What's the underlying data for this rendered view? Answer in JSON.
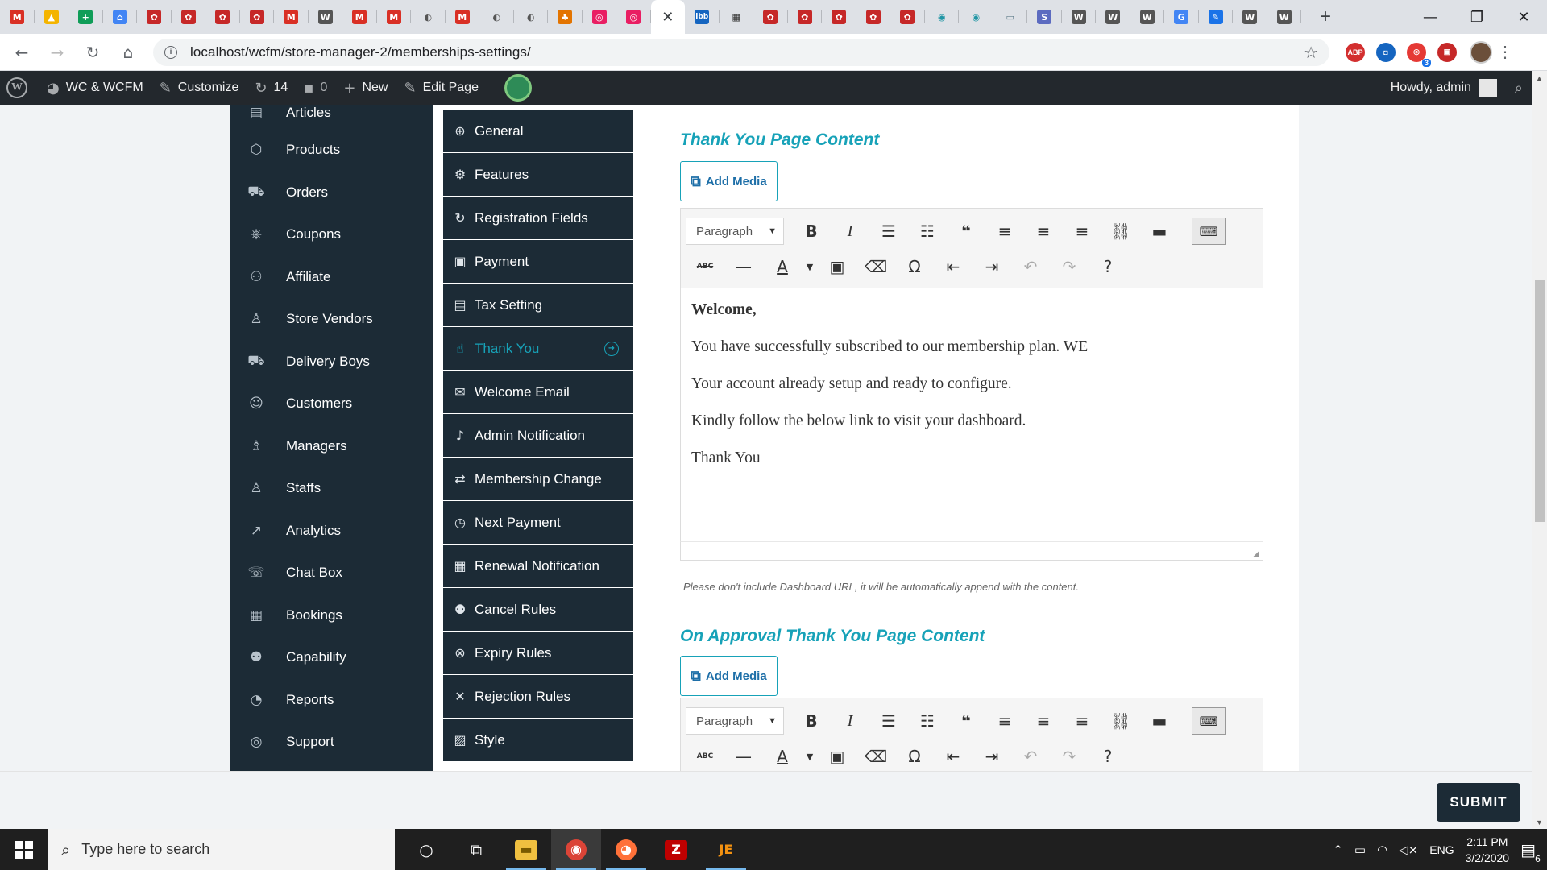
{
  "browser": {
    "tabs": [
      {
        "icon": "gmail-icon",
        "glyph": "M",
        "color": "#d93025"
      },
      {
        "icon": "drive-icon",
        "glyph": "▲",
        "color": "#f4b400"
      },
      {
        "icon": "sheets-icon",
        "glyph": "+",
        "color": "#0f9d58"
      },
      {
        "icon": "inbox-icon",
        "glyph": "⌂",
        "color": "#4285f4"
      },
      {
        "icon": "wcfm-icon",
        "glyph": "✿",
        "color": "#c62828"
      },
      {
        "icon": "wcfm-icon",
        "glyph": "✿",
        "color": "#c62828"
      },
      {
        "icon": "wcfm-icon",
        "glyph": "✿",
        "color": "#c62828"
      },
      {
        "icon": "wcfm-icon",
        "glyph": "✿",
        "color": "#c62828"
      },
      {
        "icon": "gmail-icon",
        "glyph": "M",
        "color": "#d93025"
      },
      {
        "icon": "wordpress-icon",
        "glyph": "W",
        "color": "#555555"
      },
      {
        "icon": "gmail-icon",
        "glyph": "M",
        "color": "#d93025"
      },
      {
        "icon": "gmail-icon",
        "glyph": "M",
        "color": "#d93025"
      },
      {
        "icon": "globe-icon",
        "glyph": "◐",
        "color": "#555555"
      },
      {
        "icon": "gmail-icon",
        "glyph": "M",
        "color": "#d93025"
      },
      {
        "icon": "globe-icon",
        "glyph": "◐",
        "color": "#555555"
      },
      {
        "icon": "globe-icon",
        "glyph": "◐",
        "color": "#555555"
      },
      {
        "icon": "pma-icon",
        "glyph": "♣",
        "color": "#e37400"
      },
      {
        "icon": "plugin-icon",
        "glyph": "◎",
        "color": "#e91e63"
      },
      {
        "icon": "plugin-icon",
        "glyph": "◎",
        "color": "#e91e63"
      },
      {
        "icon": "close-icon",
        "glyph": "✕",
        "color": "#3c4043",
        "active": true
      },
      {
        "icon": "ibb-icon",
        "glyph": "ibb",
        "color": "#1565c0"
      },
      {
        "icon": "clapper-icon",
        "glyph": "▦",
        "color": "#333333"
      },
      {
        "icon": "wcfm-icon",
        "glyph": "✿",
        "color": "#c62828"
      },
      {
        "icon": "wcfm-icon",
        "glyph": "✿",
        "color": "#c62828"
      },
      {
        "icon": "wcfm-icon",
        "glyph": "✿",
        "color": "#c62828"
      },
      {
        "icon": "wcfm-icon",
        "glyph": "✿",
        "color": "#c62828"
      },
      {
        "icon": "wcfm-icon",
        "glyph": "✿",
        "color": "#c62828"
      },
      {
        "icon": "globe-icon",
        "glyph": "◉",
        "color": "#2196a5"
      },
      {
        "icon": "globe-icon",
        "glyph": "◉",
        "color": "#2196a5"
      },
      {
        "icon": "monitor-icon",
        "glyph": "▭",
        "color": "#607d8b"
      },
      {
        "icon": "s-icon",
        "glyph": "S",
        "color": "#5c6bc0"
      },
      {
        "icon": "wordpress-icon",
        "glyph": "W",
        "color": "#555555"
      },
      {
        "icon": "wordpress-icon",
        "glyph": "W",
        "color": "#555555"
      },
      {
        "icon": "wordpress-icon",
        "glyph": "W",
        "color": "#555555"
      },
      {
        "icon": "google-icon",
        "glyph": "G",
        "color": "#4285f4"
      },
      {
        "icon": "feather-icon",
        "glyph": "✎",
        "color": "#1a73e8"
      },
      {
        "icon": "wordpress-icon",
        "glyph": "W",
        "color": "#555555"
      },
      {
        "icon": "wordpress-icon",
        "glyph": "W",
        "color": "#555555"
      }
    ],
    "url": "localhost/wcfm/store-manager-2/memberships-settings/",
    "extensions": [
      {
        "name": "adblock-icon",
        "text": "ABP",
        "color": "#d32f2f"
      },
      {
        "name": "camera-icon",
        "text": "◘",
        "color": "#1565c0"
      },
      {
        "name": "todo-icon",
        "text": "◎",
        "color": "#e53935",
        "badge": "3"
      },
      {
        "name": "pocket-icon",
        "text": "▣",
        "color": "#c62828"
      }
    ]
  },
  "adminbar": {
    "site_name": "WC & WCFM",
    "customize": "Customize",
    "updates_count": "14",
    "comments_count": "0",
    "new_label": "New",
    "edit_page": "Edit Page",
    "howdy": "Howdy, admin"
  },
  "left_menu": [
    {
      "label": "Articles",
      "icon": "article-icon",
      "glyph": "▤"
    },
    {
      "label": "Products",
      "icon": "cube-icon",
      "glyph": "⬡"
    },
    {
      "label": "Orders",
      "icon": "cart-icon",
      "glyph": "⛟"
    },
    {
      "label": "Coupons",
      "icon": "gift-icon",
      "glyph": "⎈"
    },
    {
      "label": "Affiliate",
      "icon": "users-icon",
      "glyph": "⚇"
    },
    {
      "label": "Store Vendors",
      "icon": "user-icon",
      "glyph": "♙"
    },
    {
      "label": "Delivery Boys",
      "icon": "truck-icon",
      "glyph": "⛟"
    },
    {
      "label": "Customers",
      "icon": "user-circle-icon",
      "glyph": "☺"
    },
    {
      "label": "Managers",
      "icon": "user-tie-icon",
      "glyph": "♗"
    },
    {
      "label": "Staffs",
      "icon": "user-icon",
      "glyph": "♙"
    },
    {
      "label": "Analytics",
      "icon": "chart-line-icon",
      "glyph": "↗"
    },
    {
      "label": "Chat Box",
      "icon": "chat-icon",
      "glyph": "☏"
    },
    {
      "label": "Bookings",
      "icon": "calendar-icon",
      "glyph": "▦"
    },
    {
      "label": "Capability",
      "icon": "user-x-icon",
      "glyph": "⚉"
    },
    {
      "label": "Reports",
      "icon": "pie-chart-icon",
      "glyph": "◔"
    },
    {
      "label": "Support",
      "icon": "lifering-icon",
      "glyph": "◎"
    }
  ],
  "sub_menu": [
    {
      "label": "General",
      "icon": "globe-icon",
      "glyph": "⊕"
    },
    {
      "label": "Features",
      "icon": "gear-icon",
      "glyph": "⚙"
    },
    {
      "label": "Registration Fields",
      "icon": "refresh-icon",
      "glyph": "↻"
    },
    {
      "label": "Payment",
      "icon": "money-icon",
      "glyph": "▣"
    },
    {
      "label": "Tax Setting",
      "icon": "id-card-icon",
      "glyph": "▤"
    },
    {
      "label": "Thank You",
      "icon": "thumbs-up-icon",
      "glyph": "☝",
      "active": true
    },
    {
      "label": "Welcome Email",
      "icon": "envelope-icon",
      "glyph": "✉"
    },
    {
      "label": "Admin Notification",
      "icon": "bell-icon",
      "glyph": "♪"
    },
    {
      "label": "Membership Change",
      "icon": "retweet-icon",
      "glyph": "⇄"
    },
    {
      "label": "Next Payment",
      "icon": "clock-icon",
      "glyph": "◷"
    },
    {
      "label": "Renewal Notification",
      "icon": "calendar-icon",
      "glyph": "▦"
    },
    {
      "label": "Cancel Rules",
      "icon": "user-x-icon",
      "glyph": "⚉"
    },
    {
      "label": "Expiry Rules",
      "icon": "circle-x-icon",
      "glyph": "⊗"
    },
    {
      "label": "Rejection Rules",
      "icon": "times-icon",
      "glyph": "✕"
    },
    {
      "label": "Style",
      "icon": "image-icon",
      "glyph": "▨"
    }
  ],
  "sections": {
    "thank_you_title": "Thank You Page Content",
    "approval_title": "On Approval Thank You Page Content",
    "add_media": "Add Media",
    "format_select": "Paragraph",
    "hint": "Please don't include Dashboard URL, it will be automatically append with the content."
  },
  "editor_content": {
    "line1": "Welcome,",
    "line2": "You have successfully subscribed to our membership plan.  WE",
    "line3": "Your account already setup and ready to configure.",
    "line4": "Kindly follow the below link to visit your dashboard.",
    "line5": "Thank You"
  },
  "submit_label": "SUBMIT",
  "taskbar": {
    "search_placeholder": "Type here to search",
    "language": "ENG",
    "time": "2:11 PM",
    "date": "3/2/2020",
    "notification_count": "6"
  },
  "colors": {
    "accent": "#17a2b8",
    "sidebar": "#1c2b36",
    "adminbar": "#23282d"
  }
}
